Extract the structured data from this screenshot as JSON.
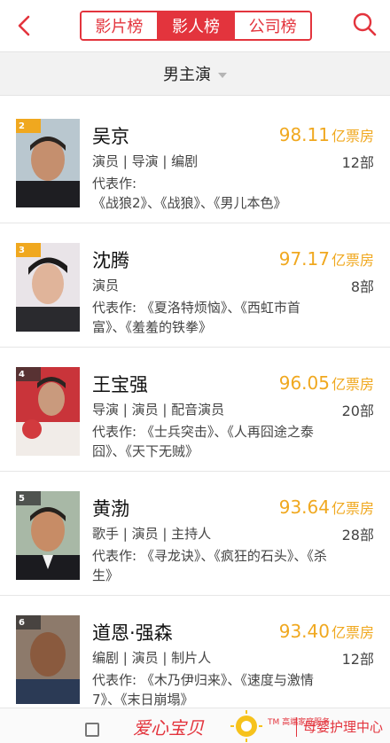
{
  "header": {
    "tabs": [
      "影片榜",
      "影人榜",
      "公司榜"
    ],
    "active_tab": 1
  },
  "filter": {
    "label": "男主演"
  },
  "rankings": [
    {
      "rank": "2",
      "name": "吴京",
      "roles": "演员 | 导演 | 编剧",
      "score": "98.11",
      "score_unit": "亿票房",
      "count": "12部",
      "works_prefix": "代表作: ",
      "works": "《战狼2》、《战狼》、《男儿本色》"
    },
    {
      "rank": "3",
      "name": "沈腾",
      "roles": "演员",
      "score": "97.17",
      "score_unit": "亿票房",
      "count": "8部",
      "works_prefix": "代表作: ",
      "works": "《夏洛特烦恼》、《西虹市首富》、《羞羞的铁拳》"
    },
    {
      "rank": "4",
      "name": "王宝强",
      "roles": "导演 | 演员 | 配音演员",
      "score": "96.05",
      "score_unit": "亿票房",
      "count": "20部",
      "works_prefix": "代表作: ",
      "works": "《士兵突击》、《人再囧途之泰囧》、《天下无贼》"
    },
    {
      "rank": "5",
      "name": "黄渤",
      "roles": "歌手 | 演员 | 主持人",
      "score": "93.64",
      "score_unit": "亿票房",
      "count": "28部",
      "works_prefix": "代表作: ",
      "works": "《寻龙诀》、《疯狂的石头》、《杀生》"
    },
    {
      "rank": "6",
      "name": "道恩·强森",
      "roles": "编剧 | 演员 | 制片人",
      "score": "93.40",
      "score_unit": "亿票房",
      "count": "12部",
      "works_prefix": "代表作: ",
      "works": "《木乃伊归来》、《速度与激情7》、《末日崩塌》"
    }
  ],
  "footer": {
    "brand_left": "爱心宝贝",
    "brand_small": "TM 高端家庭服务",
    "brand_right": "母婴护理中心"
  },
  "colors": {
    "accent": "#e3343d",
    "score": "#f0a81f"
  }
}
